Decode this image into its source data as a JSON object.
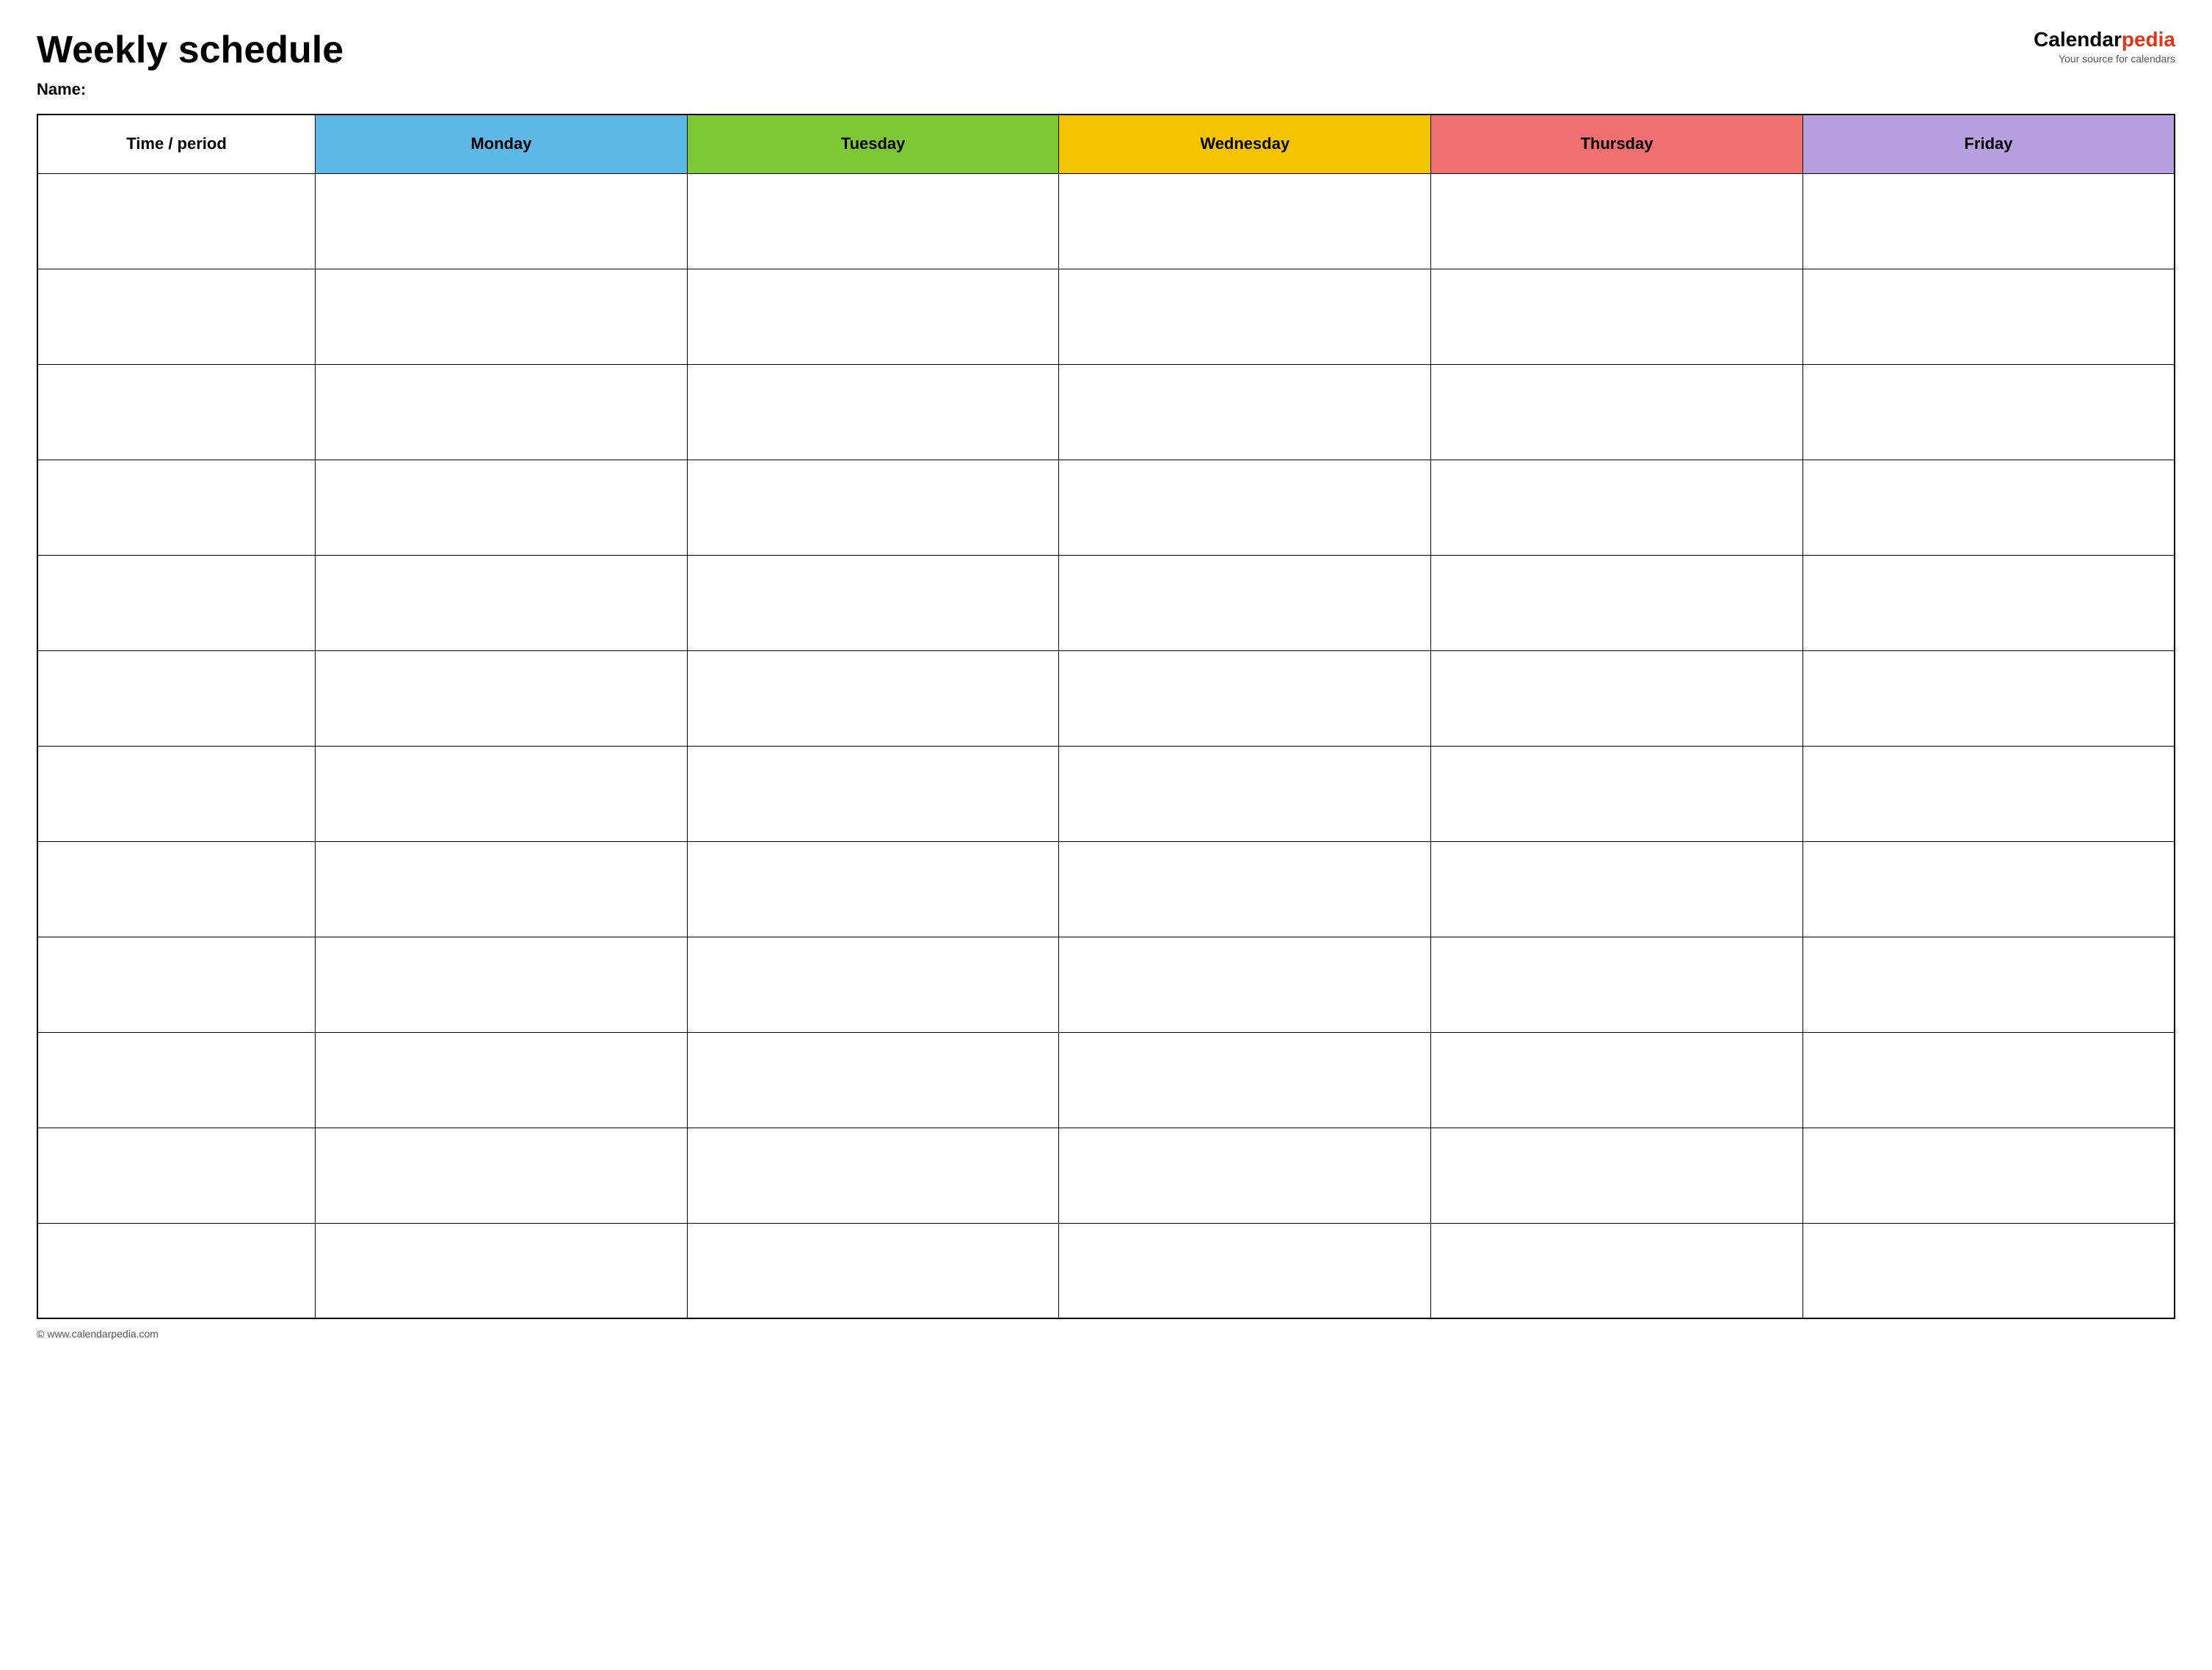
{
  "header": {
    "title": "Weekly schedule",
    "name_label": "Name:",
    "logo": {
      "calendar": "Calendar",
      "pedia": "pedia",
      "tagline": "Your source for calendars"
    }
  },
  "table": {
    "columns": [
      {
        "label": "Time / period",
        "key": "time",
        "class": "col-time"
      },
      {
        "label": "Monday",
        "key": "monday",
        "class": "col-monday"
      },
      {
        "label": "Tuesday",
        "key": "tuesday",
        "class": "col-tuesday"
      },
      {
        "label": "Wednesday",
        "key": "wednesday",
        "class": "col-wednesday"
      },
      {
        "label": "Thursday",
        "key": "thursday",
        "class": "col-thursday"
      },
      {
        "label": "Friday",
        "key": "friday",
        "class": "col-friday"
      }
    ],
    "row_count": 12
  },
  "footer": {
    "url": "© www.calendarpedia.com"
  }
}
